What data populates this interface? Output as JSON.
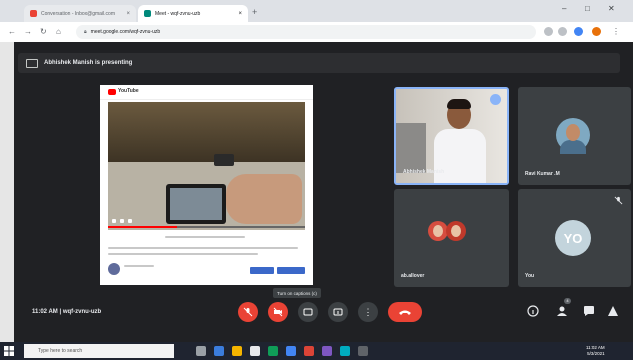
{
  "browser": {
    "tabs": [
      {
        "title": "Conversation - Inbox@gmail.com"
      },
      {
        "title": "Meet - wqf-zvnu-uzb"
      }
    ],
    "url": "meet.google.com/wqf-zvnu-uzb"
  },
  "presenting_banner": {
    "text": "Abhishek Manish is presenting"
  },
  "presentation": {
    "site_name": "YouTube",
    "video_progress": 0.35
  },
  "tiles": [
    {
      "name": "Abhishek Manish",
      "kind": "camera",
      "active": true
    },
    {
      "name": "Ravi Kumar .M",
      "kind": "photo"
    },
    {
      "name": "ab.allover",
      "kind": "photo-duo"
    },
    {
      "name": "You",
      "kind": "initials",
      "initials": "YO",
      "muted": true
    }
  ],
  "bottom_bar": {
    "time": "11:02 AM",
    "meeting_code": "wqf-zvnu-uzb",
    "tooltip": "Turn on captions (c)",
    "participants_count": "4"
  },
  "taskbar": {
    "search_placeholder": "Type here to search",
    "clock_time": "11:02 AM",
    "clock_date": "5/3/2021"
  },
  "colors": {
    "meet_bg": "#202124",
    "tile_bg": "#3c4043",
    "danger": "#ea4335",
    "accent": "#8ab4f8"
  }
}
